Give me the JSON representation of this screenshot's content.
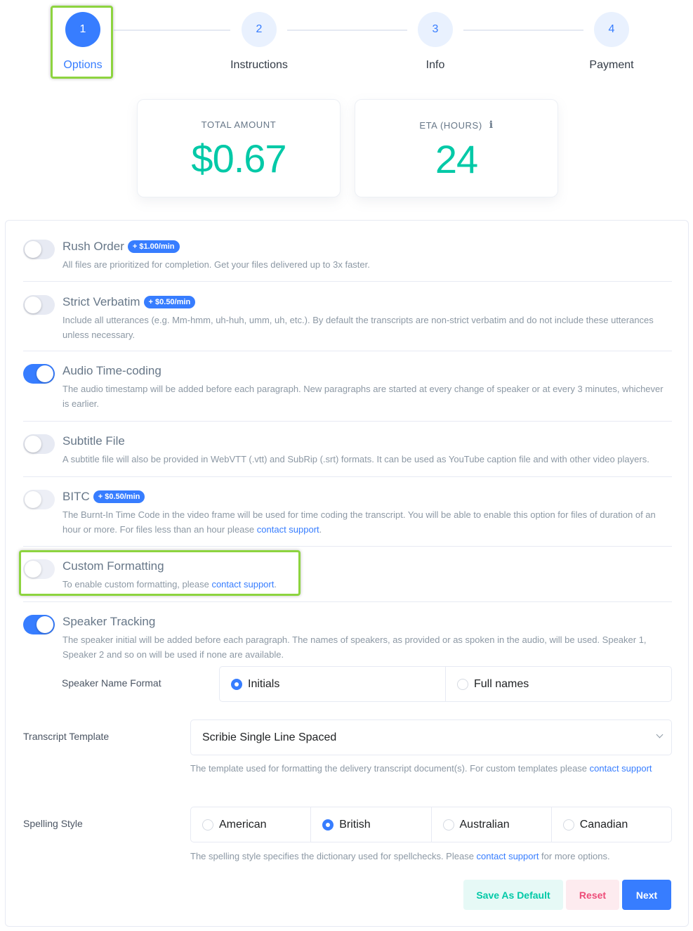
{
  "stepper": {
    "steps": [
      {
        "number": "1",
        "label": "Options",
        "active": true
      },
      {
        "number": "2",
        "label": "Instructions",
        "active": false
      },
      {
        "number": "3",
        "label": "Info",
        "active": false
      },
      {
        "number": "4",
        "label": "Payment",
        "active": false
      }
    ]
  },
  "summary": {
    "total_amount": {
      "label": "TOTAL AMOUNT",
      "value": "$0.67"
    },
    "eta": {
      "label": "ETA (HOURS)",
      "value": "24",
      "icon": "info-icon"
    }
  },
  "options": [
    {
      "title": "Rush Order",
      "badge": "+ $1.00/min",
      "enabled": false,
      "description": "All files are prioritized for completion. Get your files delivered up to 3x faster."
    },
    {
      "title": "Strict Verbatim",
      "badge": "+ $0.50/min",
      "enabled": false,
      "description": "Include all utterances (e.g. Mm-hmm, uh-huh, umm, uh, etc.). By default the transcripts are non-strict verbatim and do not include these utterances unless necessary."
    },
    {
      "title": "Audio Time-coding",
      "enabled": true,
      "description": "The audio timestamp will be added before each paragraph. New paragraphs are started at every change of speaker or at every 3 minutes, whichever is earlier."
    },
    {
      "title": "Subtitle File",
      "enabled": false,
      "description": "A subtitle file will also be provided in WebVTT (.vtt) and SubRip (.srt) formats. It can be used as YouTube caption file and with other video players."
    },
    {
      "title": "BITC",
      "badge": "+ $0.50/min",
      "enabled": false,
      "description": "The Burnt-In Time Code in the video frame will be used for time coding the transcript. You will be able to enable this option for files of duration of an hour or more. For files less than an hour please ",
      "link": "contact support",
      "suffix": "."
    },
    {
      "title": "Custom Formatting",
      "enabled": false,
      "description": "To enable custom formatting, please ",
      "link": "contact support",
      "suffix": "."
    },
    {
      "title": "Speaker Tracking",
      "enabled": true,
      "description": "The speaker initial will be added before each paragraph. The names of speakers, as provided or as spoken in the audio, will be used. Speaker 1, Speaker 2 and so on will be used if none are available."
    }
  ],
  "speaker_name_format": {
    "label": "Speaker Name Format",
    "options": [
      {
        "label": "Initials",
        "checked": true
      },
      {
        "label": "Full names",
        "checked": false
      }
    ]
  },
  "transcript_template": {
    "label": "Transcript Template",
    "selected": "Scribie Single Line Spaced",
    "help": "The template used for formatting the delivery transcript document(s). For custom templates please ",
    "link": "contact support"
  },
  "spelling_style": {
    "label": "Spelling Style",
    "options": [
      {
        "label": "American",
        "checked": false
      },
      {
        "label": "British",
        "checked": true
      },
      {
        "label": "Australian",
        "checked": false
      },
      {
        "label": "Canadian",
        "checked": false
      }
    ],
    "help_prefix": "The spelling style specifies the dictionary used for spellchecks. Please ",
    "link": "contact support",
    "help_suffix": " for more options."
  },
  "buttons": {
    "save_default": "Save As Default",
    "reset": "Reset",
    "next": "Next"
  },
  "colors": {
    "primary": "#377dff",
    "success": "#00c9a7",
    "danger": "#ed4c78",
    "highlight": "#8dd43f"
  }
}
